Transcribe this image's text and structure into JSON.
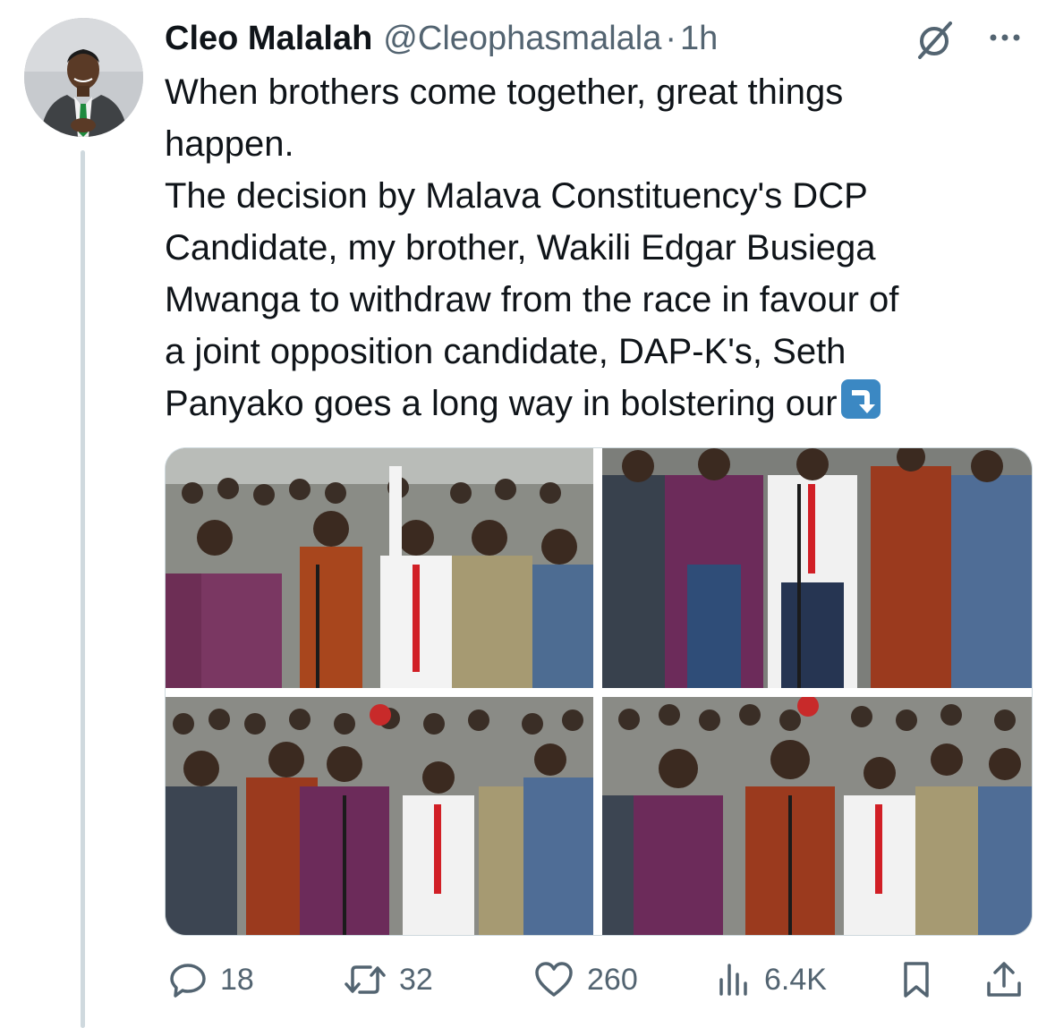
{
  "tweet": {
    "author_name": "Cleo Malalah",
    "author_handle": "@Cleophasmalala",
    "separator": "·",
    "time": "1h",
    "text_lines": [
      "When brothers come together, great things",
      "happen.",
      "The decision by Malava Constituency's DCP",
      "Candidate, my brother, Wakili Edgar Busiega",
      "Mwanga to withdraw from the race in favour of",
      "a joint opposition candidate, DAP-K's, Seth",
      "Panyako goes a long way in bolstering our"
    ],
    "media_count": 4
  },
  "actions": {
    "replies": "18",
    "reposts": "32",
    "likes": "260",
    "views": "6.4K"
  },
  "icons": {
    "reply": "reply-icon",
    "repost": "repost-icon",
    "like": "heart-icon",
    "views": "views-icon",
    "bookmark": "bookmark-icon",
    "share": "share-icon",
    "grok": "grok-icon",
    "more": "more-icon",
    "emoji": "arrow-down-right-emoji"
  },
  "colors": {
    "text": "#0f1419",
    "secondary": "#536471",
    "thread_line": "#cfd9de",
    "emoji_blue": "#3b88c3"
  }
}
